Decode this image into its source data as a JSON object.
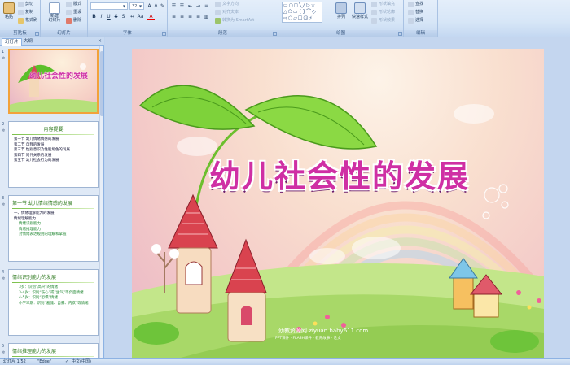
{
  "ribbon": {
    "groups": {
      "clipboard": "剪贴板",
      "slides": "幻灯片",
      "font": "字体",
      "paragraph": "段落",
      "drawing": "绘图",
      "editing": "编辑"
    },
    "paste": "粘贴",
    "cut": "剪切",
    "copy": "复制",
    "format_painter": "格式刷",
    "new_slide": "新建\n幻灯片",
    "layout": "版式",
    "reset": "重设",
    "delete": "删除",
    "font_size": "32",
    "text_direction": "文字方向",
    "align_text": "对齐文本",
    "convert_smartart": "转换为 SmartArt",
    "arrange": "排列",
    "quick_styles": "快速样式",
    "shape_fill": "形状填充",
    "shape_outline": "形状轮廓",
    "shape_effects": "形状效果",
    "find": "查找",
    "replace": "替换",
    "select": "选择"
  },
  "left_pane": {
    "tab_slides": "幻灯片",
    "tab_outline": "大纲",
    "close": "×",
    "thumbs": [
      {
        "num": "1",
        "title": "幼儿社会性的发展"
      },
      {
        "num": "2",
        "title": "内容提要",
        "lines": [
          "第一节 幼儿情绪情感的发展",
          "第二节 自我的发展",
          "第三节 性别意识及性别角色的发展",
          "第四节 同伴关系的发展",
          "第五节 幼儿社会行为的发展"
        ]
      },
      {
        "num": "3",
        "title": "第一节 幼儿情绪情感的发展",
        "lines": [
          "一、情绪理解能力的发展",
          "情绪理解能力"
        ],
        "glines": [
          "情绪识别能力",
          "情绪推理能力",
          "对情绪表达规则的理解和掌握"
        ]
      },
      {
        "num": "4",
        "title": "情绪识别能力的发展",
        "glines": [
          "3岁：识别“高兴”的情绪",
          "3-4岁：识别“伤心”或“生气”等负面情绪",
          "4-5岁：识别“恐惧”情绪",
          "小学早期：识别“羞愧、自豪、内疚”等情绪"
        ]
      },
      {
        "num": "5",
        "title": "情绪推理能力的发展"
      }
    ]
  },
  "slide": {
    "title": "幼儿社会性的发展",
    "watermark": "幼教资源网 ziyuan.baby611.com",
    "watermark_sub": "PPT课件 · FLASH课件 · 教育故事 · 论文"
  },
  "status_bar": {
    "slide_count": "幻灯片 1/52",
    "theme": "\"Edge\"",
    "language": "中文(中国)"
  }
}
